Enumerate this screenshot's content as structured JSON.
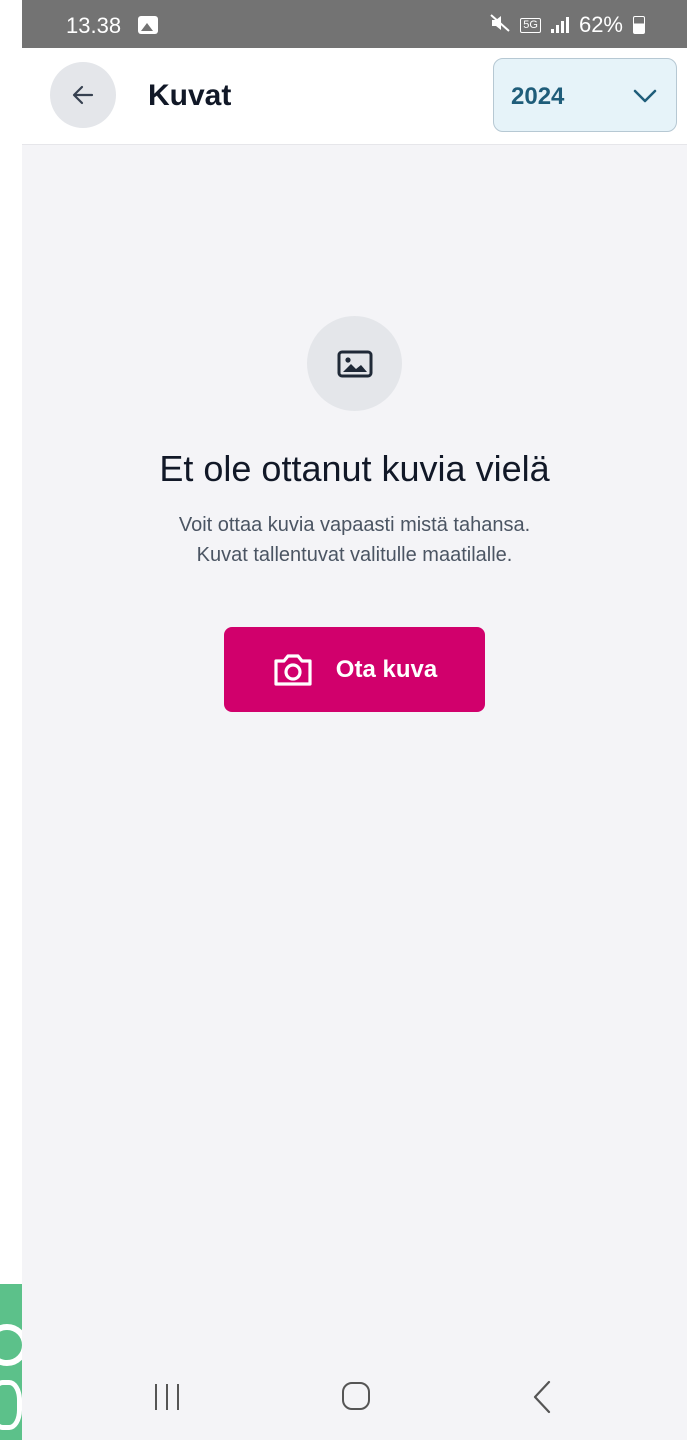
{
  "status_bar": {
    "time": "13.38",
    "network": "5G",
    "battery": "62%"
  },
  "header": {
    "title": "Kuvat",
    "year_select": {
      "selected": "2024"
    }
  },
  "empty_state": {
    "title": "Et ole ottanut kuvia vielä",
    "description_line1": "Voit ottaa kuvia vapaasti mistä tahansa.",
    "description_line2": "Kuvat tallentuvat valitulle maatilalle.",
    "button_label": "Ota kuva"
  },
  "colors": {
    "accent": "#d1006c",
    "status_bar": "#737373",
    "select_bg": "#e6f3f9",
    "select_text": "#1f5d7a"
  },
  "icons": {
    "back": "arrow-left-icon",
    "dropdown": "chevron-down-icon",
    "placeholder": "image-icon",
    "button": "camera-icon",
    "nav": [
      "recents-icon",
      "home-icon",
      "back-icon"
    ]
  }
}
